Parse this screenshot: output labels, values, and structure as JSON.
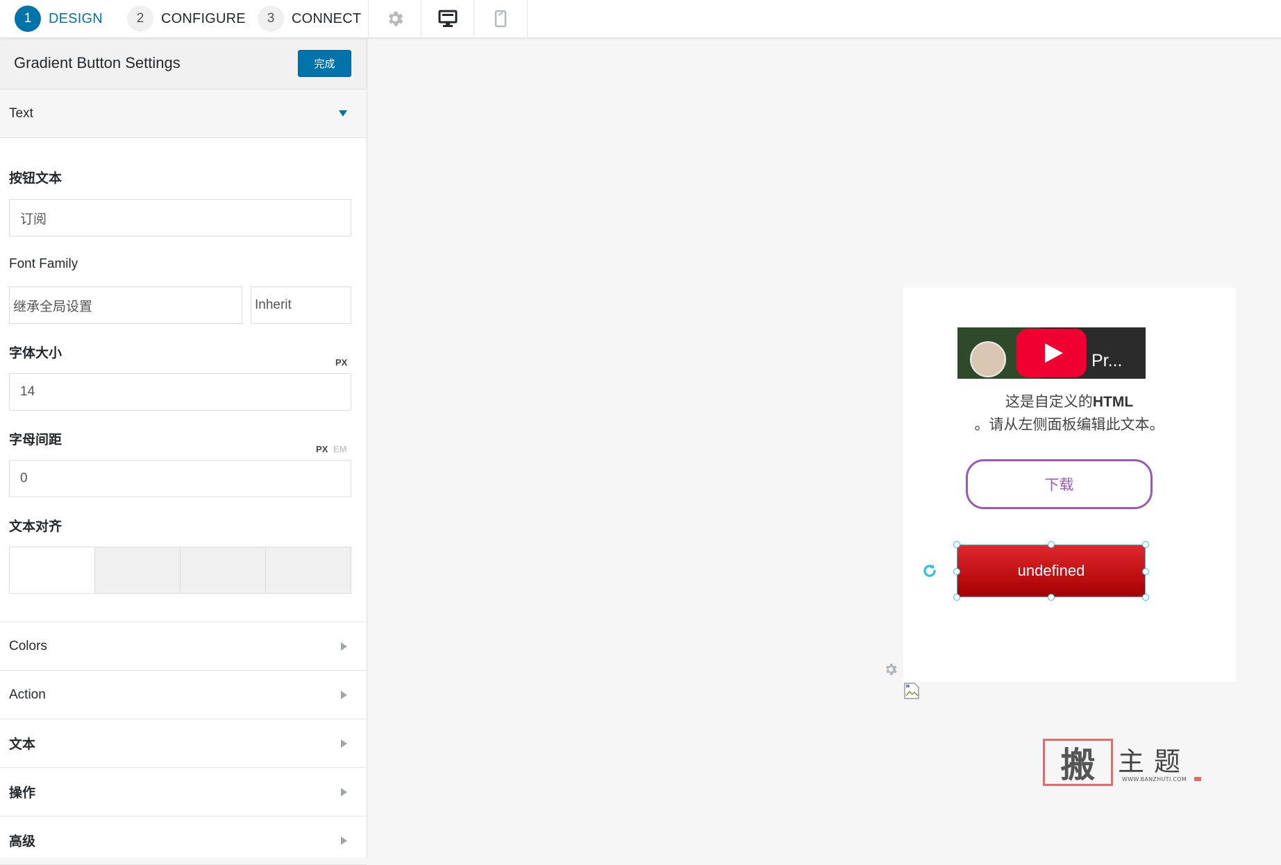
{
  "steps": [
    {
      "num": "1",
      "label": "DESIGN",
      "active": true
    },
    {
      "num": "2",
      "label": "CONFIGURE",
      "active": false
    },
    {
      "num": "3",
      "label": "CONNECT",
      "active": false
    }
  ],
  "toolbar_icons": [
    "gear-icon",
    "desktop-icon",
    "mobile-icon"
  ],
  "panel": {
    "title": "Gradient Button Settings",
    "done_label": "完成"
  },
  "sections": {
    "text": "Text",
    "colors": "Colors",
    "action": "Action",
    "cn_text": "文本",
    "cn_action": "操作",
    "advanced": "高级"
  },
  "fields": {
    "button_text": {
      "label": "按钮文本",
      "value": "订阅"
    },
    "font_family": {
      "label": "Font Family",
      "value": "继承全局设置",
      "weight": "Inherit"
    },
    "font_size": {
      "label": "字体大小",
      "unit": "PX",
      "value": "14"
    },
    "letter_spacing": {
      "label": "字母间距",
      "unit_px": "PX",
      "unit_em": "EM",
      "value": "0"
    },
    "text_align": {
      "label": "文本对齐",
      "selected_index": 0
    }
  },
  "preview": {
    "video_title": "Pr...",
    "html_text_pre": "这是自定义的",
    "html_text_bold": "HTML",
    "html_text_post": "。请从左侧面板编辑此文本。",
    "outline_button": "下载",
    "gradient_button": "undefined"
  },
  "watermark": {
    "stamp_char": "搬",
    "chars": "主题",
    "url": "WWW.BANZHUTI.COM"
  },
  "colors": {
    "accent": "#0073aa",
    "outline_button": "#9b59b6",
    "gradient_top": "#e0282e",
    "gradient_bottom": "#a60000",
    "selection": "#2ec4e0"
  }
}
